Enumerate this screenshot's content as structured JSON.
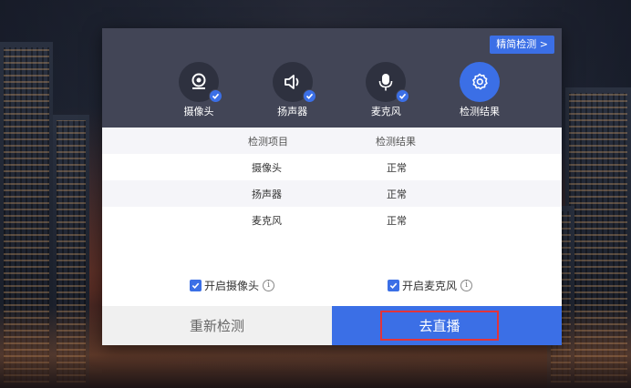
{
  "header": {
    "simple_check_label": "精简检测 >",
    "steps": [
      {
        "label": "摄像头",
        "icon": "camera-icon",
        "done": true
      },
      {
        "label": "扬声器",
        "icon": "speaker-icon",
        "done": true
      },
      {
        "label": "麦克风",
        "icon": "microphone-icon",
        "done": true
      },
      {
        "label": "检测结果",
        "icon": "gear-icon",
        "active": true
      }
    ]
  },
  "results": {
    "columns": [
      "检测项目",
      "检测结果"
    ],
    "rows": [
      {
        "item": "摄像头",
        "result": "正常"
      },
      {
        "item": "扬声器",
        "result": "正常"
      },
      {
        "item": "麦克风",
        "result": "正常"
      }
    ]
  },
  "options": {
    "camera_label": "开启摄像头",
    "camera_checked": true,
    "mic_label": "开启麦克风",
    "mic_checked": true
  },
  "footer": {
    "retest_label": "重新检测",
    "go_live_label": "去直播"
  },
  "colors": {
    "accent": "#3b6fe6",
    "header_bg": "#424556",
    "highlight_border": "#e2343a"
  }
}
